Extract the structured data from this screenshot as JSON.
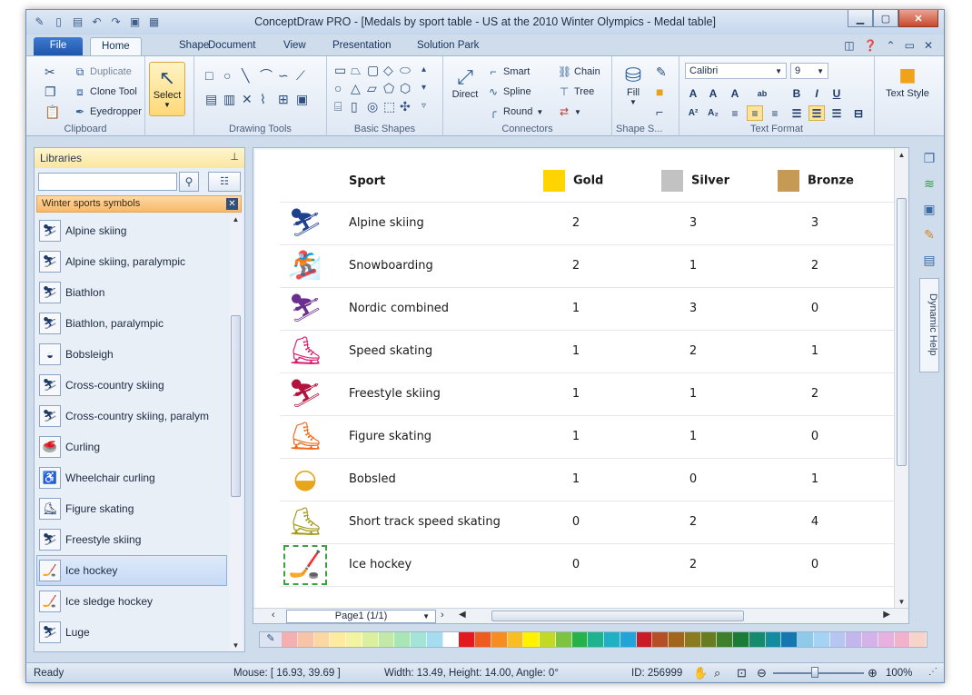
{
  "window": {
    "title": "ConceptDraw PRO - [Medals by sport table - US at the 2010 Winter Olympics - Medal table]",
    "controls": [
      "minimize",
      "maximize",
      "close"
    ]
  },
  "ribbon_tabs": [
    {
      "label": "File"
    },
    {
      "label": "Home",
      "active": true
    },
    {
      "label": "Shape"
    },
    {
      "label": "Document"
    },
    {
      "label": "View"
    },
    {
      "label": "Presentation"
    },
    {
      "label": "Solution Park"
    }
  ],
  "ribbon": {
    "clipboard": {
      "label": "Clipboard",
      "items": [
        "Duplicate",
        "Clone Tool",
        "Eyedropper"
      ]
    },
    "select": {
      "label": "Select"
    },
    "drawing_tools": {
      "label": "Drawing Tools"
    },
    "basic_shapes": {
      "label": "Basic Shapes"
    },
    "connectors": {
      "label": "Connectors",
      "direct": "Direct",
      "items": [
        "Smart",
        "Spline",
        "Round",
        "Chain",
        "Tree"
      ]
    },
    "shape_style": {
      "label": "Shape S...",
      "fill": "Fill"
    },
    "text_format": {
      "label": "Text Format",
      "font": "Calibri",
      "size": "9",
      "bold": "B",
      "italic": "I",
      "underline": "U"
    },
    "text_style": {
      "label": "Text Style"
    }
  },
  "libraries": {
    "header": "Libraries",
    "search_value": "",
    "library_title": "Winter sports symbols",
    "items": [
      {
        "label": "Alpine skiing"
      },
      {
        "label": "Alpine skiing, paralympic"
      },
      {
        "label": "Biathlon"
      },
      {
        "label": "Biathlon, paralympic"
      },
      {
        "label": "Bobsleigh"
      },
      {
        "label": "Cross-country skiing"
      },
      {
        "label": "Cross-country skiing, paralym"
      },
      {
        "label": "Curling"
      },
      {
        "label": "Wheelchair curling"
      },
      {
        "label": "Figure skating"
      },
      {
        "label": "Freestyle skiing"
      },
      {
        "label": "Ice hockey",
        "selected": true
      },
      {
        "label": "Ice sledge hockey"
      },
      {
        "label": "Luge"
      }
    ]
  },
  "medal_table": {
    "headers": {
      "sport": "Sport",
      "gold": "Gold",
      "silver": "Silver",
      "bronze": "Bronze"
    },
    "medal_colors": {
      "gold": "#ffd400",
      "silver": "#c2c2c2",
      "bronze": "#c49a55"
    },
    "rows": [
      {
        "sport": "Alpine skiing",
        "gold": "2",
        "silver": "3",
        "bronze": "3",
        "icon": "alpine-skiing-icon",
        "color": "#1f3f8f"
      },
      {
        "sport": "Snowboarding",
        "gold": "2",
        "silver": "1",
        "bronze": "2",
        "icon": "snowboarding-icon",
        "color": "#3a5ea8"
      },
      {
        "sport": "Nordic combined",
        "gold": "1",
        "silver": "3",
        "bronze": "0",
        "icon": "nordic-combined-icon",
        "color": "#6a2f8e"
      },
      {
        "sport": "Speed skating",
        "gold": "1",
        "silver": "2",
        "bronze": "1",
        "icon": "speed-skating-icon",
        "color": "#d81e6e"
      },
      {
        "sport": "Freestyle skiing",
        "gold": "1",
        "silver": "1",
        "bronze": "2",
        "icon": "freestyle-skiing-icon",
        "color": "#b3123c"
      },
      {
        "sport": "Figure skating",
        "gold": "1",
        "silver": "1",
        "bronze": "0",
        "icon": "figure-skating-icon",
        "color": "#ef6a1c"
      },
      {
        "sport": "Bobsled",
        "gold": "1",
        "silver": "0",
        "bronze": "1",
        "icon": "bobsled-icon",
        "color": "#e7a61a"
      },
      {
        "sport": "Short track speed skating",
        "gold": "0",
        "silver": "2",
        "bronze": "4",
        "icon": "short-track-icon",
        "color": "#a39a1a"
      },
      {
        "sport": "Ice hockey",
        "gold": "0",
        "silver": "2",
        "bronze": "0",
        "icon": "ice-hockey-icon",
        "color": "#2e7d3e"
      }
    ]
  },
  "page_nav": {
    "current": "Page1 (1/1)"
  },
  "palette": [
    "#f4b0b0",
    "#f9c3a8",
    "#fbd7a1",
    "#fdeb9f",
    "#f4f3a0",
    "#dbef9f",
    "#c2eaa6",
    "#a9e6b6",
    "#a4e4d6",
    "#a6dcef",
    "#ffffff",
    "#e4191e",
    "#ee5a1f",
    "#f58d20",
    "#fbbe22",
    "#fff200",
    "#c3da24",
    "#7cc43f",
    "#27b14a",
    "#1fb28f",
    "#1fb0c4",
    "#24a3d9",
    "#c91c27",
    "#b45124",
    "#a1661c",
    "#8a7a20",
    "#687d22",
    "#3d7f2a",
    "#1c7b36",
    "#178a6e",
    "#148c9f",
    "#1477b0",
    "#8fcbe9",
    "#a5d3f4",
    "#b6c6f1",
    "#c3b6ec",
    "#d4b3e8",
    "#e6b1de",
    "#f2b2cc",
    "#f7d4c8"
  ],
  "dynamic_help": "Dynamic Help",
  "status": {
    "ready": "Ready",
    "mouse": "Mouse: [ 16.93, 39.69 ]",
    "size": "Width: 13.49,  Height: 14.00,  Angle: 0°",
    "id": "ID: 256999",
    "zoom": "100%"
  }
}
